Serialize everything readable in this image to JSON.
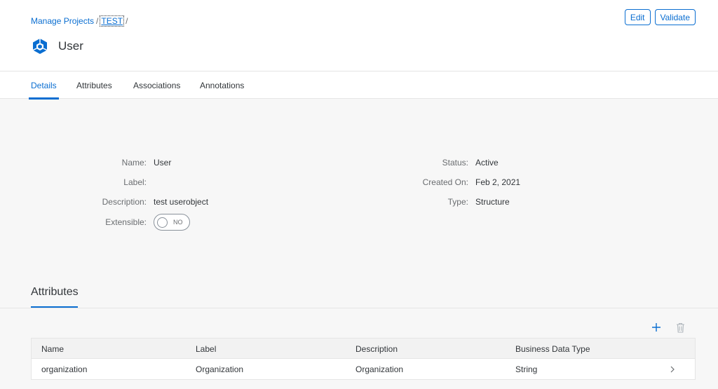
{
  "breadcrumb": {
    "root": "Manage Projects",
    "current": "TEST",
    "sep": "/"
  },
  "header": {
    "title": "User",
    "icon": "cube-object-icon",
    "edit_label": "Edit",
    "validate_label": "Validate"
  },
  "tabs": [
    {
      "label": "Details",
      "active": true
    },
    {
      "label": "Attributes",
      "active": false
    },
    {
      "label": "Associations",
      "active": false
    },
    {
      "label": "Annotations",
      "active": false
    }
  ],
  "details": {
    "name_label": "Name:",
    "name_value": "User",
    "label_label": "Label:",
    "label_value": "",
    "description_label": "Description:",
    "description_value": "test userobject",
    "extensible_label": "Extensible:",
    "extensible_value": "NO",
    "status_label": "Status:",
    "status_value": "Active",
    "created_label": "Created On:",
    "created_value": "Feb 2, 2021",
    "type_label": "Type:",
    "type_value": "Structure"
  },
  "attributes_section": {
    "title": "Attributes",
    "columns": [
      "Name",
      "Label",
      "Description",
      "Business Data Type"
    ],
    "rows": [
      {
        "name": "organization",
        "label": "Organization",
        "description": "Organization",
        "type": "String"
      }
    ]
  },
  "colors": {
    "accent": "#0a6ed1",
    "text": "#32363a",
    "muted": "#6a6d70",
    "background": "#f7f7f7"
  }
}
